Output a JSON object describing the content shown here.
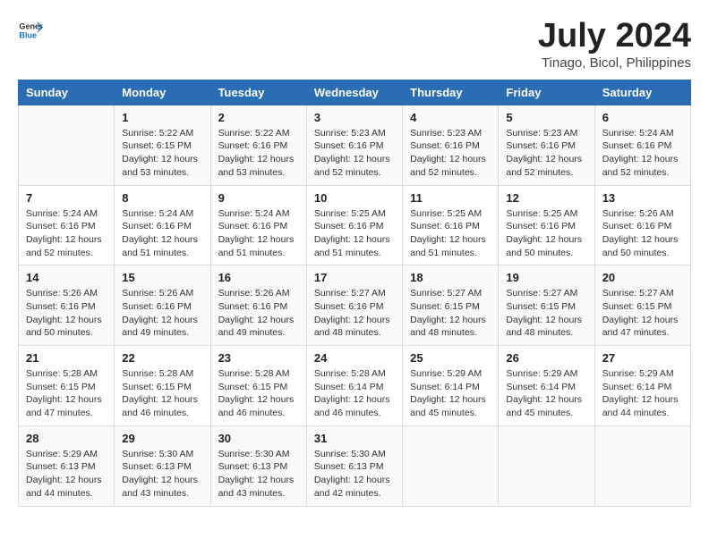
{
  "header": {
    "logo_general": "General",
    "logo_blue": "Blue",
    "title": "July 2024",
    "subtitle": "Tinago, Bicol, Philippines"
  },
  "columns": [
    "Sunday",
    "Monday",
    "Tuesday",
    "Wednesday",
    "Thursday",
    "Friday",
    "Saturday"
  ],
  "weeks": [
    [
      {
        "day": "",
        "info": ""
      },
      {
        "day": "1",
        "info": "Sunrise: 5:22 AM\nSunset: 6:15 PM\nDaylight: 12 hours\nand 53 minutes."
      },
      {
        "day": "2",
        "info": "Sunrise: 5:22 AM\nSunset: 6:16 PM\nDaylight: 12 hours\nand 53 minutes."
      },
      {
        "day": "3",
        "info": "Sunrise: 5:23 AM\nSunset: 6:16 PM\nDaylight: 12 hours\nand 52 minutes."
      },
      {
        "day": "4",
        "info": "Sunrise: 5:23 AM\nSunset: 6:16 PM\nDaylight: 12 hours\nand 52 minutes."
      },
      {
        "day": "5",
        "info": "Sunrise: 5:23 AM\nSunset: 6:16 PM\nDaylight: 12 hours\nand 52 minutes."
      },
      {
        "day": "6",
        "info": "Sunrise: 5:24 AM\nSunset: 6:16 PM\nDaylight: 12 hours\nand 52 minutes."
      }
    ],
    [
      {
        "day": "7",
        "info": "Sunrise: 5:24 AM\nSunset: 6:16 PM\nDaylight: 12 hours\nand 52 minutes."
      },
      {
        "day": "8",
        "info": "Sunrise: 5:24 AM\nSunset: 6:16 PM\nDaylight: 12 hours\nand 51 minutes."
      },
      {
        "day": "9",
        "info": "Sunrise: 5:24 AM\nSunset: 6:16 PM\nDaylight: 12 hours\nand 51 minutes."
      },
      {
        "day": "10",
        "info": "Sunrise: 5:25 AM\nSunset: 6:16 PM\nDaylight: 12 hours\nand 51 minutes."
      },
      {
        "day": "11",
        "info": "Sunrise: 5:25 AM\nSunset: 6:16 PM\nDaylight: 12 hours\nand 51 minutes."
      },
      {
        "day": "12",
        "info": "Sunrise: 5:25 AM\nSunset: 6:16 PM\nDaylight: 12 hours\nand 50 minutes."
      },
      {
        "day": "13",
        "info": "Sunrise: 5:26 AM\nSunset: 6:16 PM\nDaylight: 12 hours\nand 50 minutes."
      }
    ],
    [
      {
        "day": "14",
        "info": "Sunrise: 5:26 AM\nSunset: 6:16 PM\nDaylight: 12 hours\nand 50 minutes."
      },
      {
        "day": "15",
        "info": "Sunrise: 5:26 AM\nSunset: 6:16 PM\nDaylight: 12 hours\nand 49 minutes."
      },
      {
        "day": "16",
        "info": "Sunrise: 5:26 AM\nSunset: 6:16 PM\nDaylight: 12 hours\nand 49 minutes."
      },
      {
        "day": "17",
        "info": "Sunrise: 5:27 AM\nSunset: 6:16 PM\nDaylight: 12 hours\nand 48 minutes."
      },
      {
        "day": "18",
        "info": "Sunrise: 5:27 AM\nSunset: 6:15 PM\nDaylight: 12 hours\nand 48 minutes."
      },
      {
        "day": "19",
        "info": "Sunrise: 5:27 AM\nSunset: 6:15 PM\nDaylight: 12 hours\nand 48 minutes."
      },
      {
        "day": "20",
        "info": "Sunrise: 5:27 AM\nSunset: 6:15 PM\nDaylight: 12 hours\nand 47 minutes."
      }
    ],
    [
      {
        "day": "21",
        "info": "Sunrise: 5:28 AM\nSunset: 6:15 PM\nDaylight: 12 hours\nand 47 minutes."
      },
      {
        "day": "22",
        "info": "Sunrise: 5:28 AM\nSunset: 6:15 PM\nDaylight: 12 hours\nand 46 minutes."
      },
      {
        "day": "23",
        "info": "Sunrise: 5:28 AM\nSunset: 6:15 PM\nDaylight: 12 hours\nand 46 minutes."
      },
      {
        "day": "24",
        "info": "Sunrise: 5:28 AM\nSunset: 6:14 PM\nDaylight: 12 hours\nand 46 minutes."
      },
      {
        "day": "25",
        "info": "Sunrise: 5:29 AM\nSunset: 6:14 PM\nDaylight: 12 hours\nand 45 minutes."
      },
      {
        "day": "26",
        "info": "Sunrise: 5:29 AM\nSunset: 6:14 PM\nDaylight: 12 hours\nand 45 minutes."
      },
      {
        "day": "27",
        "info": "Sunrise: 5:29 AM\nSunset: 6:14 PM\nDaylight: 12 hours\nand 44 minutes."
      }
    ],
    [
      {
        "day": "28",
        "info": "Sunrise: 5:29 AM\nSunset: 6:13 PM\nDaylight: 12 hours\nand 44 minutes."
      },
      {
        "day": "29",
        "info": "Sunrise: 5:30 AM\nSunset: 6:13 PM\nDaylight: 12 hours\nand 43 minutes."
      },
      {
        "day": "30",
        "info": "Sunrise: 5:30 AM\nSunset: 6:13 PM\nDaylight: 12 hours\nand 43 minutes."
      },
      {
        "day": "31",
        "info": "Sunrise: 5:30 AM\nSunset: 6:13 PM\nDaylight: 12 hours\nand 42 minutes."
      },
      {
        "day": "",
        "info": ""
      },
      {
        "day": "",
        "info": ""
      },
      {
        "day": "",
        "info": ""
      }
    ]
  ]
}
